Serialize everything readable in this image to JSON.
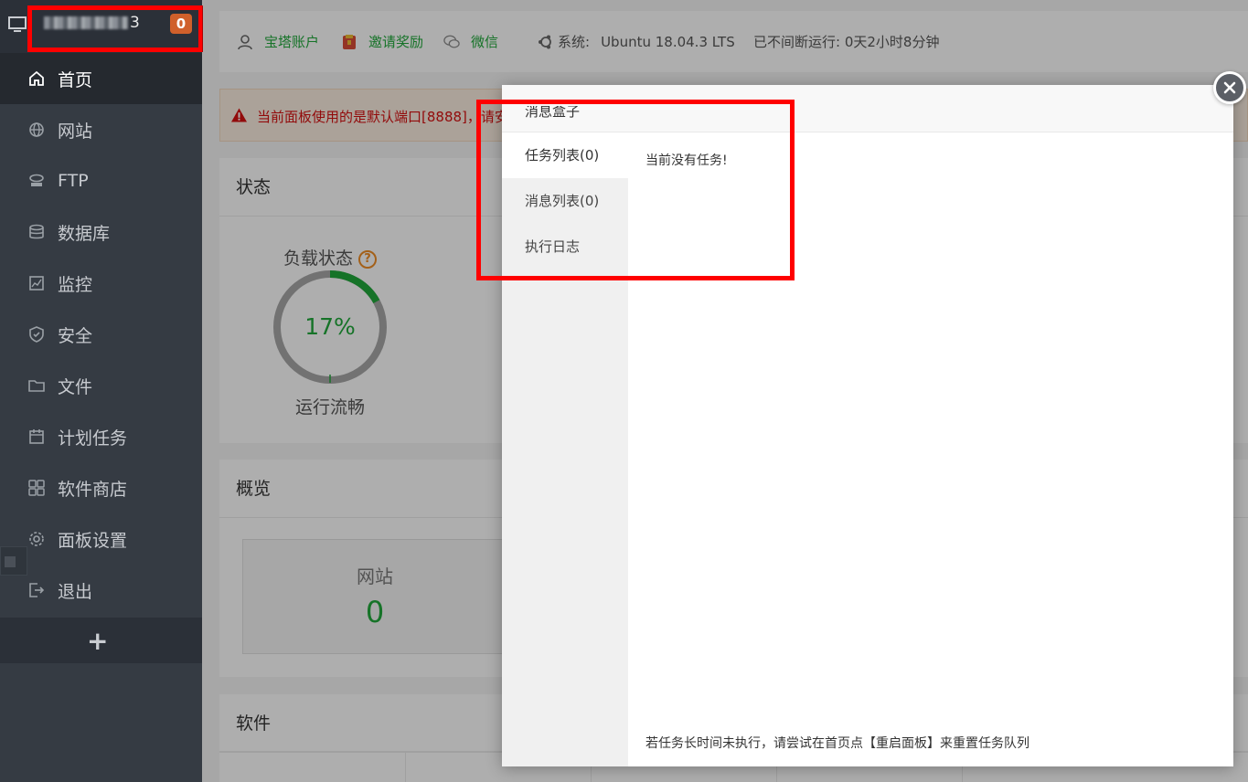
{
  "sidebar": {
    "server_ip_visible": "3",
    "notification_count": "0",
    "items": [
      {
        "label": "首页",
        "icon": "home-icon",
        "active": true
      },
      {
        "label": "网站",
        "icon": "globe-icon"
      },
      {
        "label": "FTP",
        "icon": "ftp-icon"
      },
      {
        "label": "数据库",
        "icon": "database-icon"
      },
      {
        "label": "监控",
        "icon": "monitor-chart-icon"
      },
      {
        "label": "安全",
        "icon": "shield-icon"
      },
      {
        "label": "文件",
        "icon": "folder-icon"
      },
      {
        "label": "计划任务",
        "icon": "calendar-icon"
      },
      {
        "label": "软件商店",
        "icon": "apps-grid-icon"
      },
      {
        "label": "面板设置",
        "icon": "gear-icon"
      },
      {
        "label": "退出",
        "icon": "logout-icon"
      }
    ],
    "add_label": "+"
  },
  "topbar": {
    "account": "宝塔账户",
    "invite": "邀请奖励",
    "wechat": "微信",
    "system_label": "系统:",
    "system_value": "Ubuntu 18.04.3 LTS",
    "uptime": "已不间断运行: 0天2小时8分钟"
  },
  "warning": {
    "text": "当前面板使用的是默认端口[8888]，请安"
  },
  "status_panel": {
    "title": "状态",
    "load_title": "负载状态",
    "load_value": "17%",
    "load_percent": 17,
    "load_desc": "运行流畅",
    "help": "?"
  },
  "overview_panel": {
    "title": "概览",
    "card_label": "网站",
    "card_value": "0"
  },
  "software_panel": {
    "title": "软件"
  },
  "modal": {
    "title": "消息盒子",
    "tabs": [
      "任务列表(0)",
      "消息列表(0)",
      "执行日志"
    ],
    "empty_text": "当前没有任务!",
    "footer_text": "若任务长时间未执行，请尝试在首页点【重启面板】来重置任务队列"
  },
  "colors": {
    "accent": "#20a53a",
    "sidebar_bg": "#353b43",
    "warning_text": "#d21111",
    "badge": "#d0602b",
    "highlight_box": "#ff0000"
  }
}
